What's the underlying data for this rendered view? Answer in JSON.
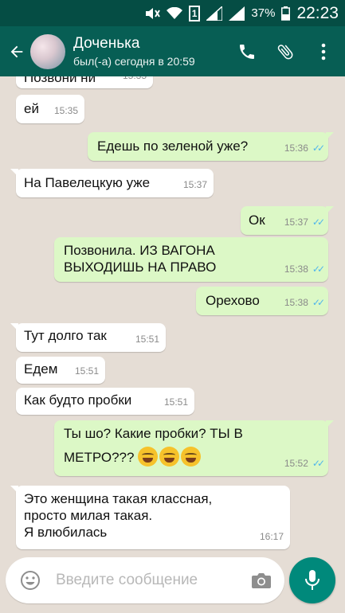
{
  "statusbar": {
    "battery": "37%",
    "time": "22:23",
    "sim": "1"
  },
  "header": {
    "name": "Доченька",
    "status": "был(-а) сегодня в 20:59"
  },
  "messages": [
    {
      "dir": "in",
      "text": "Позвони ни",
      "time": "15:35"
    },
    {
      "dir": "in",
      "text": "ей",
      "time": "15:35"
    },
    {
      "dir": "out",
      "text": "Едешь по зеленой уже?",
      "time": "15:36"
    },
    {
      "dir": "in",
      "text": "На Павелецкую уже",
      "time": "15:37"
    },
    {
      "dir": "out",
      "text": "Ок",
      "time": "15:37"
    },
    {
      "dir": "out",
      "text": "Позвонила. ИЗ ВАГОНА\nВЫХОДИШЬ НА ПРАВО",
      "time": "15:38"
    },
    {
      "dir": "out",
      "text": "Орехово",
      "time": "15:38"
    },
    {
      "dir": "in",
      "text": "Тут долго так",
      "time": "15:51"
    },
    {
      "dir": "in",
      "text": "Едем",
      "time": "15:51"
    },
    {
      "dir": "in",
      "text": "Как будто пробки",
      "time": "15:51"
    },
    {
      "dir": "out",
      "text": "Ты шо? Какие пробки? ТЫ В",
      "text2": "МЕТРО???",
      "time": "15:52"
    },
    {
      "dir": "in",
      "text": "Это женщина такая классная,\nпросто милая такая.\nЯ влюбилась",
      "time": "16:17"
    }
  ],
  "composer": {
    "placeholder": "Введите сообщение"
  },
  "colors": {
    "header": "#075e54",
    "statusbar": "#054d44",
    "outgoing": "#dcf8c6",
    "incoming": "#ffffff",
    "read_ticks": "#4fb6ec",
    "fab": "#00897b"
  },
  "icons": [
    "back-arrow-icon",
    "phone-icon",
    "paperclip-icon",
    "more-vert-icon",
    "emoji-icon",
    "camera-icon",
    "mic-icon"
  ]
}
